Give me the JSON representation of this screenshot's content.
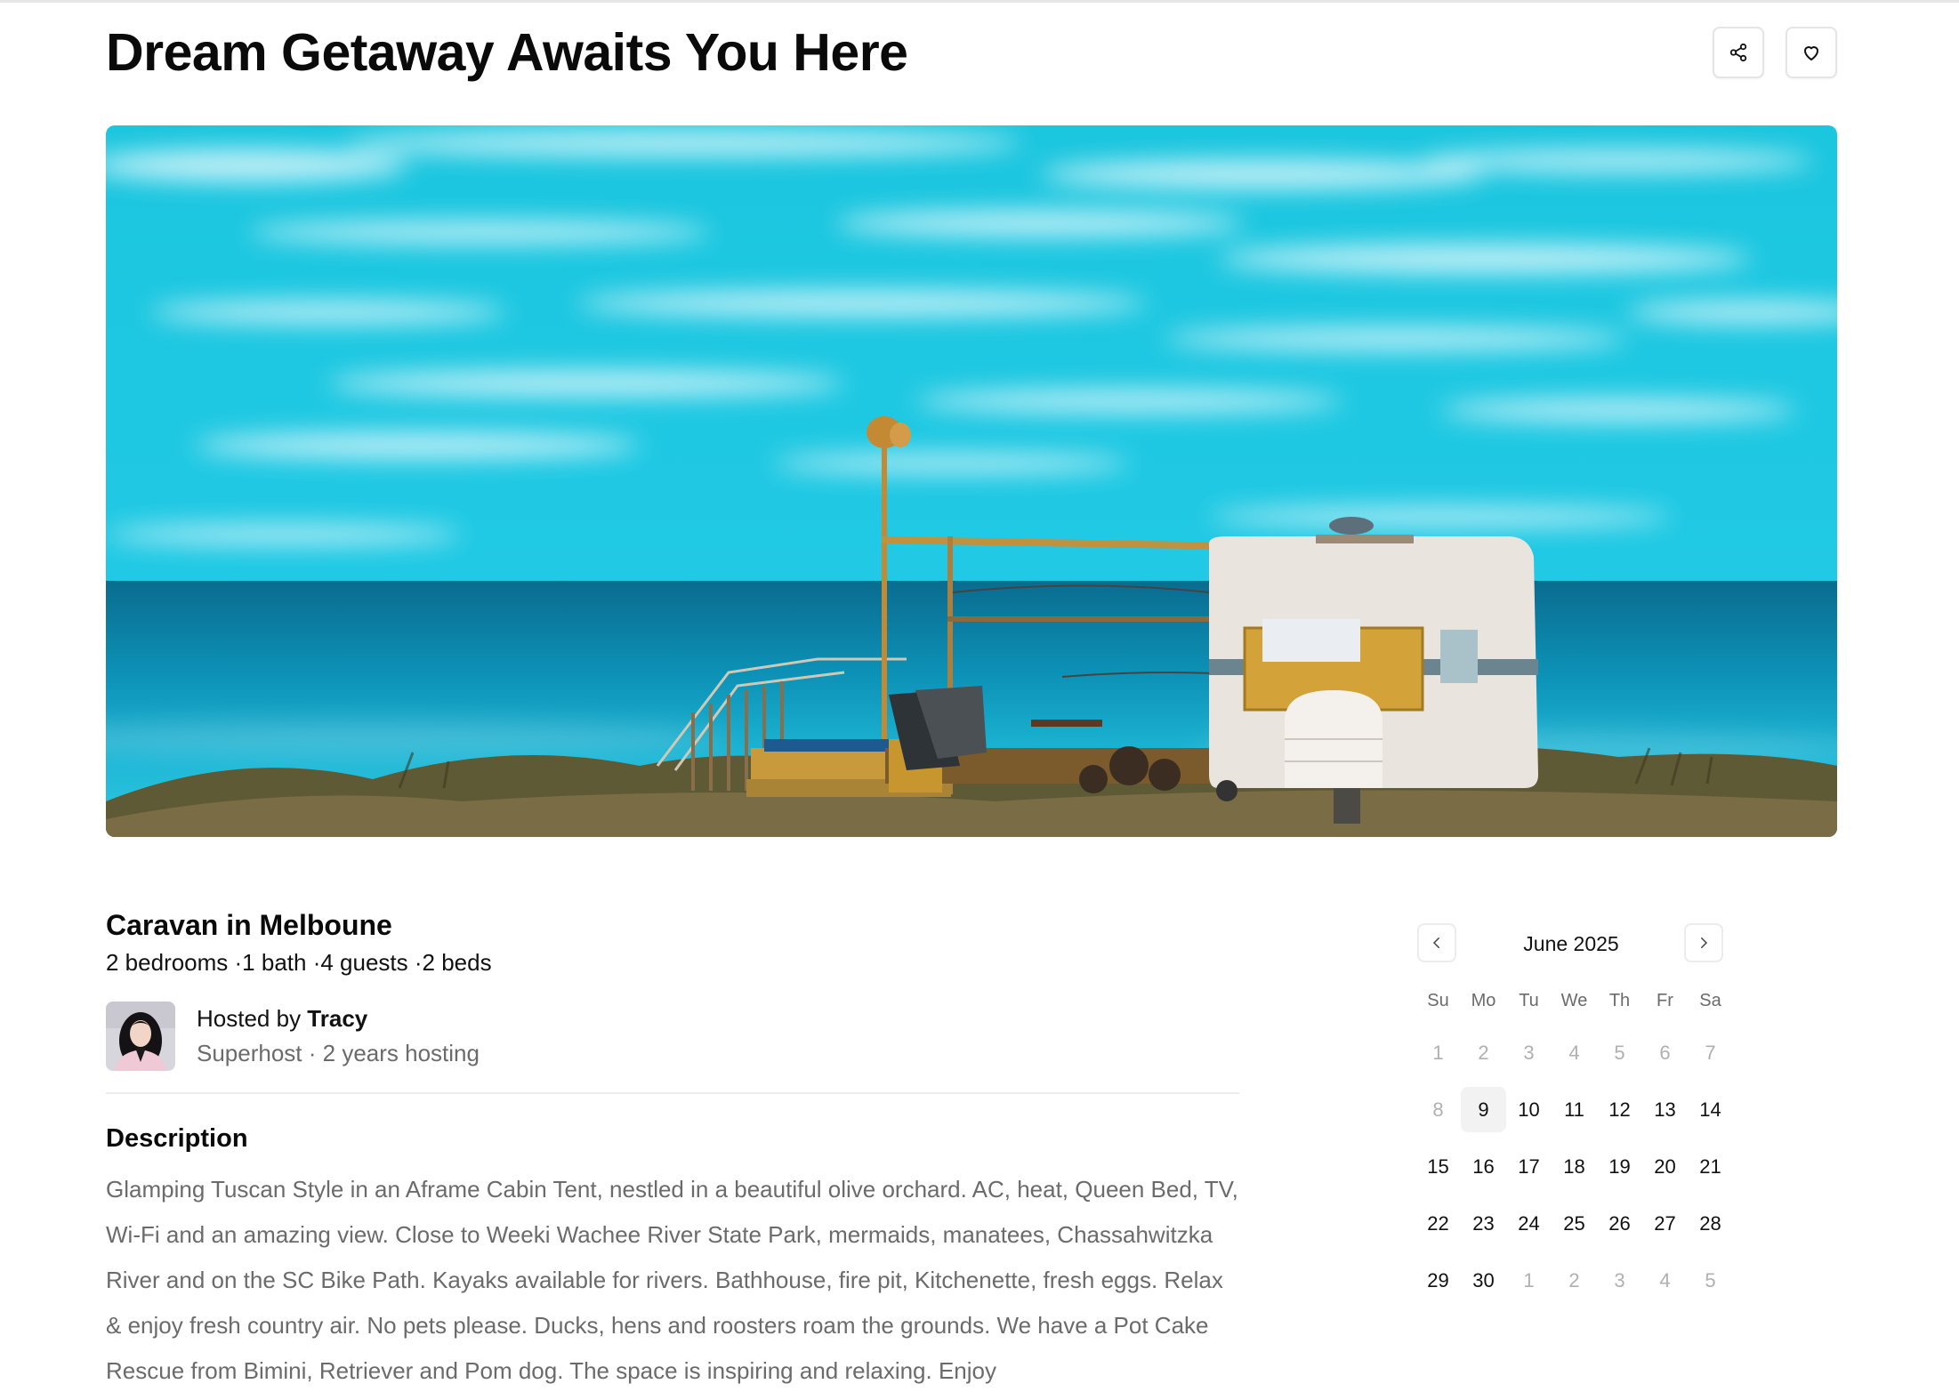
{
  "header": {
    "title": "Dream Getaway Awaits You Here",
    "share_icon": "share-icon",
    "favorite_icon": "heart-icon"
  },
  "hero": {
    "icon": "hero-photo"
  },
  "listing": {
    "title": "Caravan in Melboune",
    "meta": "2 bedrooms ·1 bath ·4 guests ·2 beds",
    "host_prefix": "Hosted by ",
    "host_name": "Tracy",
    "host_sub": "Superhost · 2 years hosting",
    "description_title": "Description",
    "description": "Glamping Tuscan Style in an Aframe Cabin Tent, nestled in a beautiful olive orchard. AC, heat, Queen Bed, TV, Wi-Fi and an amazing view. Close to Weeki Wachee River State Park, mermaids, manatees, Chassahwitzka River and on the SC Bike Path. Kayaks available for rivers. Bathhouse, fire pit, Kitchenette, fresh eggs. Relax & enjoy fresh country air. No pets please. Ducks, hens and roosters roam the grounds. We have a Pot Cake Rescue from Bimini, Retriever and Pom dog. The space is inspiring and relaxing. Enjoy"
  },
  "calendar": {
    "month_label": "June 2025",
    "prev_icon": "chevron-left-icon",
    "next_icon": "chevron-right-icon",
    "weekdays": [
      "Su",
      "Mo",
      "Tu",
      "We",
      "Th",
      "Fr",
      "Sa"
    ],
    "days": [
      {
        "label": "1",
        "state": "disabled"
      },
      {
        "label": "2",
        "state": "disabled"
      },
      {
        "label": "3",
        "state": "disabled"
      },
      {
        "label": "4",
        "state": "disabled"
      },
      {
        "label": "5",
        "state": "disabled"
      },
      {
        "label": "6",
        "state": "disabled"
      },
      {
        "label": "7",
        "state": "disabled"
      },
      {
        "label": "8",
        "state": "disabled"
      },
      {
        "label": "9",
        "state": "today"
      },
      {
        "label": "10",
        "state": "available"
      },
      {
        "label": "11",
        "state": "available"
      },
      {
        "label": "12",
        "state": "available"
      },
      {
        "label": "13",
        "state": "available"
      },
      {
        "label": "14",
        "state": "available"
      },
      {
        "label": "15",
        "state": "available"
      },
      {
        "label": "16",
        "state": "available"
      },
      {
        "label": "17",
        "state": "available"
      },
      {
        "label": "18",
        "state": "available"
      },
      {
        "label": "19",
        "state": "available"
      },
      {
        "label": "20",
        "state": "available"
      },
      {
        "label": "21",
        "state": "available"
      },
      {
        "label": "22",
        "state": "available"
      },
      {
        "label": "23",
        "state": "available"
      },
      {
        "label": "24",
        "state": "available"
      },
      {
        "label": "25",
        "state": "available"
      },
      {
        "label": "26",
        "state": "available"
      },
      {
        "label": "27",
        "state": "available"
      },
      {
        "label": "28",
        "state": "available"
      },
      {
        "label": "29",
        "state": "available"
      },
      {
        "label": "30",
        "state": "available"
      },
      {
        "label": "1",
        "state": "outside"
      },
      {
        "label": "2",
        "state": "outside"
      },
      {
        "label": "3",
        "state": "outside"
      },
      {
        "label": "4",
        "state": "outside"
      },
      {
        "label": "5",
        "state": "outside"
      }
    ]
  },
  "colors": {
    "text": "#0a0a0a",
    "muted_text": "#6b6b6b",
    "disabled_day": "#b0b0b0",
    "today_bg": "#f2f2f2",
    "sky": "#16c3dd",
    "sea": "#0b8fb3"
  }
}
